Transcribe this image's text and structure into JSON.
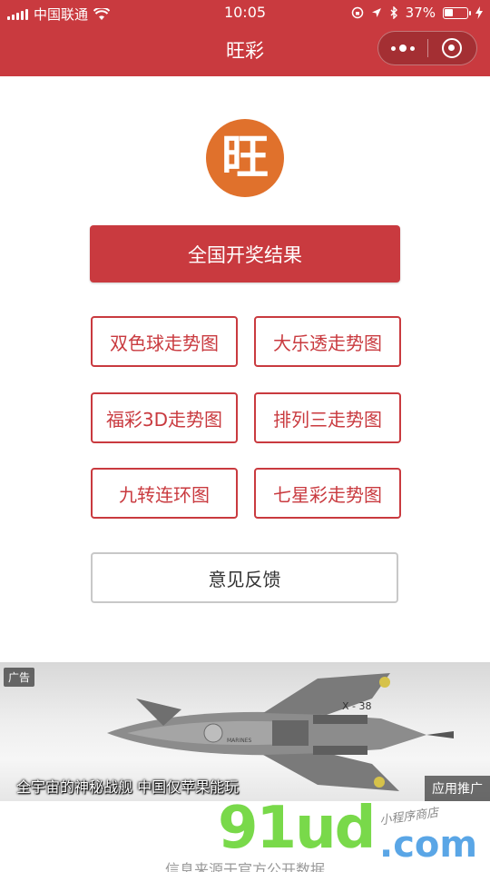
{
  "status_bar": {
    "carrier": "中国联通",
    "time": "10:05",
    "battery_percent": "37%",
    "battery_level": 0.37,
    "icons": [
      "signal-icon",
      "wifi-icon",
      "lock-rotation-icon",
      "location-icon",
      "bluetooth-icon",
      "battery-icon",
      "charging-icon"
    ]
  },
  "nav": {
    "title": "旺彩",
    "capsule_icons": [
      "more-icon",
      "close-icon"
    ]
  },
  "logo": {
    "text": "旺"
  },
  "primary_button": "全国开奖结果",
  "grid_buttons": [
    "双色球走势图",
    "大乐透走势图",
    "福彩3D走势图",
    "排列三走势图",
    "九转连环图",
    "七星彩走势图"
  ],
  "feedback_button": "意见反馈",
  "ad": {
    "tag": "广告",
    "caption": "全宇宙的神秘战舰 中国仅苹果能玩",
    "promo": "应用推广",
    "ship_label_1": "X - 38",
    "ship_label_2": "MARINES"
  },
  "footer_text": "信息来源于官方公开数据",
  "watermark": {
    "main": "91ud",
    "com": ".com",
    "sub": "小程序商店"
  },
  "colors": {
    "brand": "#c93a3f",
    "logo_bg": "#e0712c"
  }
}
